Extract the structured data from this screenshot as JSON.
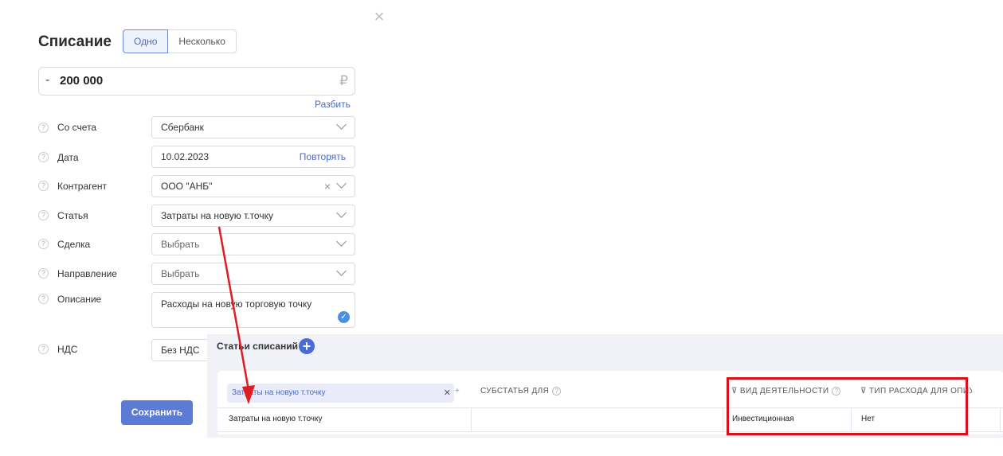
{
  "dialog": {
    "title": "Списание",
    "close_glyph": "×",
    "modes": [
      "Одно",
      "Несколько"
    ],
    "amount": {
      "sign": "-",
      "value": "200 000",
      "currency": "₽"
    },
    "split_link": "Разбить",
    "fields": {
      "account": {
        "label": "Со счета",
        "value": "Сбербанк"
      },
      "date": {
        "label": "Дата",
        "value": "10.02.2023",
        "action": "Повторять"
      },
      "counterparty": {
        "label": "Контрагент",
        "value": "ООО \"АНБ\""
      },
      "article": {
        "label": "Статья",
        "value": "Затраты на новую т.точку"
      },
      "deal": {
        "label": "Сделка",
        "placeholder": "Выбрать"
      },
      "direction": {
        "label": "Направление",
        "placeholder": "Выбрать"
      },
      "description": {
        "label": "Описание",
        "value": "Расходы на новую торговую точку"
      },
      "vat": {
        "label": "НДС",
        "value": "Без НДС"
      }
    },
    "save_label": "Сохранить"
  },
  "panel": {
    "title": "Статьи списаний",
    "add_glyph": "+",
    "filter_chip": "Затраты на новую т.точку",
    "columns": {
      "subarticle": "СУБСТАТЬЯ ДЛЯ",
      "activity": "ВИД ДЕЯТЕЛЬНОСТИ",
      "expense_type": "ТИП РАСХОДА ДЛЯ ОПИУ"
    },
    "row": {
      "article": "Затраты на новую т.точку",
      "subarticle": "",
      "activity": "Инвестиционная",
      "expense_type": "Нет"
    }
  },
  "colors": {
    "accent": "#5b7bd5",
    "highlight": "#d8121d"
  }
}
